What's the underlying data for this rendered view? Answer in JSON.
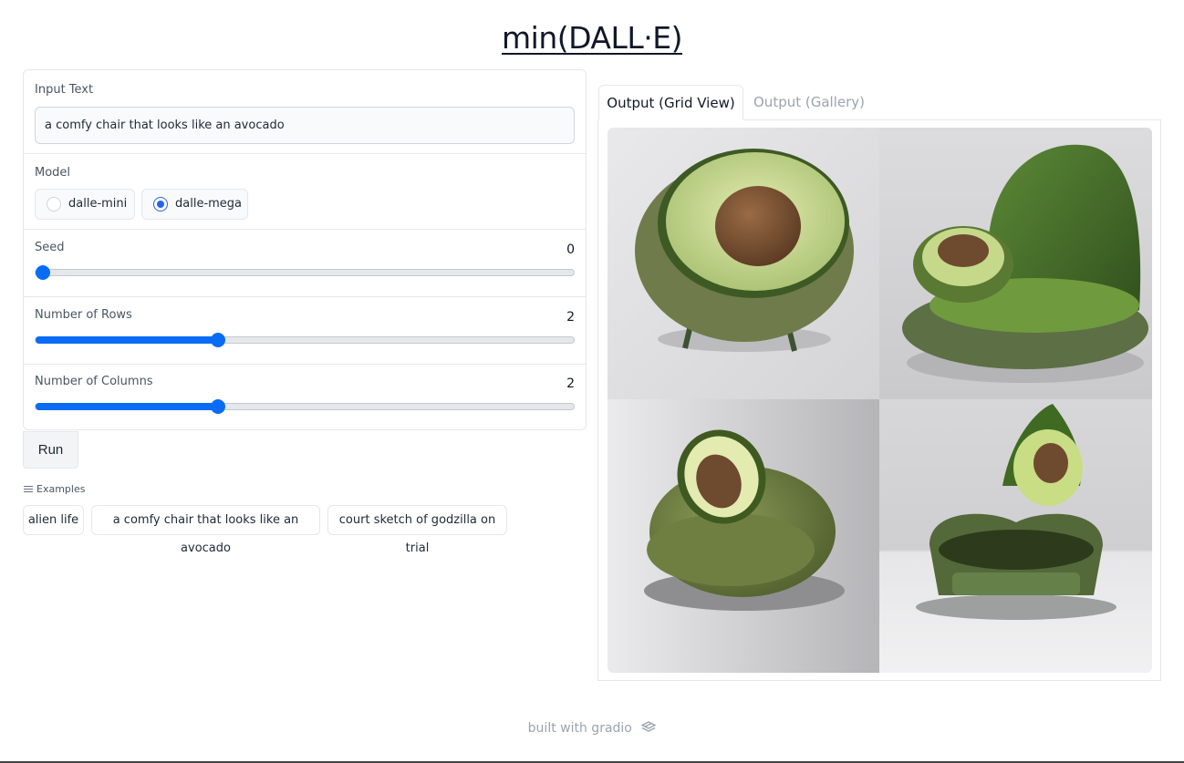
{
  "page": {
    "title": "min(DALL·E)"
  },
  "input_text": {
    "label": "Input Text",
    "value": "a comfy chair that looks like an avocado"
  },
  "model": {
    "label": "Model",
    "options": [
      "dalle-mini",
      "dalle-mega"
    ],
    "selected": "dalle-mega"
  },
  "seed": {
    "label": "Seed",
    "value": "0"
  },
  "rows": {
    "label": "Number of Rows",
    "value": "2"
  },
  "columns": {
    "label": "Number of Columns",
    "value": "2"
  },
  "run_button": {
    "label": "Run"
  },
  "examples": {
    "label": "Examples",
    "items": [
      "alien life",
      "a comfy chair that looks like an avocado",
      "court sketch of godzilla on trial"
    ]
  },
  "output": {
    "tabs": [
      "Output (Grid View)",
      "Output (Gallery)"
    ],
    "active_tab": "Output (Grid View)",
    "images": [
      "avocado-chair-1",
      "avocado-chair-2",
      "avocado-chair-3",
      "avocado-chair-4"
    ]
  },
  "footer": {
    "text": "built with gradio",
    "icon": "gradio-logo-icon"
  },
  "colors": {
    "accent": "#0a6cf5",
    "radio_selected": "#2563eb",
    "avocado_green": "#7a8f3e",
    "pit_brown": "#6e4a2f"
  }
}
